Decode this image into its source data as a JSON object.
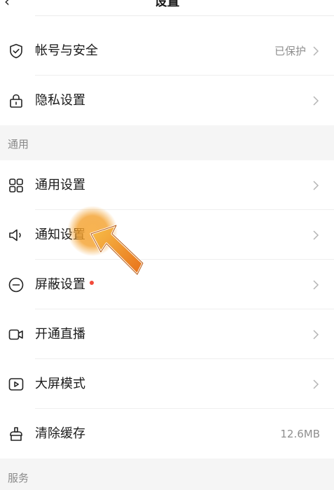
{
  "header": {
    "back_icon": "back-arrow-icon",
    "title": "设置"
  },
  "account_items": [
    {
      "label": "帐号与安全",
      "value": "已保护",
      "icon": "shield-check-icon"
    },
    {
      "label": "隐私设置",
      "value": "",
      "icon": "lock-icon"
    }
  ],
  "sections": {
    "general": "通用",
    "service": "服务"
  },
  "general_items": [
    {
      "label": "通用设置",
      "value": "",
      "icon": "grid-icon"
    },
    {
      "label": "通知设置",
      "value": "",
      "icon": "speaker-icon"
    },
    {
      "label": "屏蔽设置",
      "value": "",
      "icon": "block-icon",
      "badge": "red-dot"
    },
    {
      "label": "开通直播",
      "value": "",
      "icon": "video-camera-icon"
    },
    {
      "label": "大屏模式",
      "value": "",
      "icon": "play-screen-icon"
    },
    {
      "label": "清除缓存",
      "value": "12.6MB",
      "icon": "broom-icon"
    }
  ],
  "colors": {
    "background": "#ffffff",
    "section_bg": "#f5f5f5",
    "secondary_text": "#8f8f8f",
    "badge_dot": "#f24a3a",
    "pointer_orange": "#f39a1e"
  }
}
